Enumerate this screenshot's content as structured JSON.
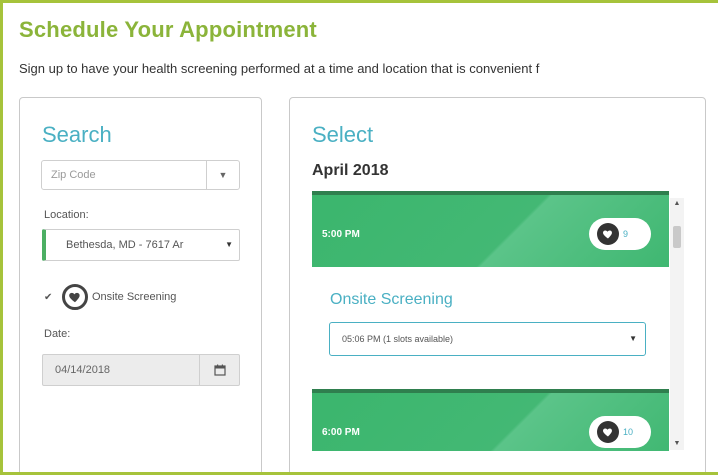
{
  "page": {
    "title": "Schedule Your Appointment",
    "subtitle": "Sign up to have your health screening performed at a time and location that is convenient f"
  },
  "search": {
    "heading": "Search",
    "zip_placeholder": "Zip Code",
    "zip_button_icon": "chevron-down-icon",
    "location_label": "Location:",
    "location_value": "Bethesda, MD - 7617 Ar",
    "onsite_checked": true,
    "onsite_label": "Onsite Screening",
    "date_label": "Date:",
    "date_value": "04/14/2018",
    "calendar_icon": "calendar-icon"
  },
  "select": {
    "heading": "Select",
    "month": "April 2018",
    "slots": [
      {
        "time": "5:00 PM",
        "count": "9"
      },
      {
        "time": "6:00 PM",
        "count": "10"
      }
    ],
    "screening_heading": "Onsite Screening",
    "time_option": "05:06 PM (1 slots available)"
  },
  "colors": {
    "frame_border": "#a6c33b",
    "title_green": "#8bb43a",
    "heading_teal": "#4ab0c3",
    "slot_green": "#3bb66d",
    "location_accent": "#4caf63"
  }
}
